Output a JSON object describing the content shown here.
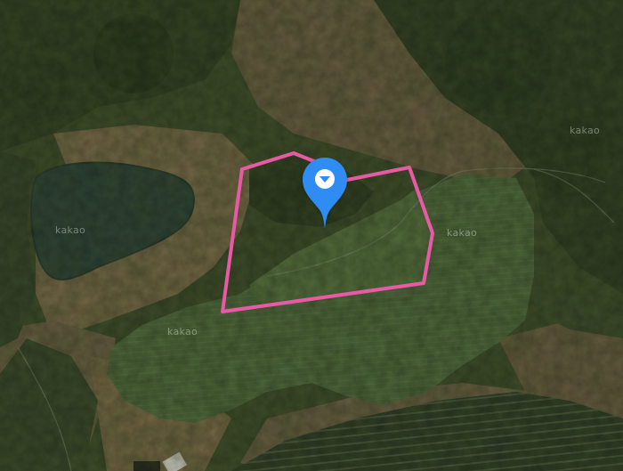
{
  "map": {
    "provider_watermark": "kakao",
    "view": "satellite"
  },
  "parcel": {
    "outline_color": "#e85aa6"
  },
  "marker": {
    "color": "#2f8cf2",
    "icon": "chevron-down-icon"
  }
}
